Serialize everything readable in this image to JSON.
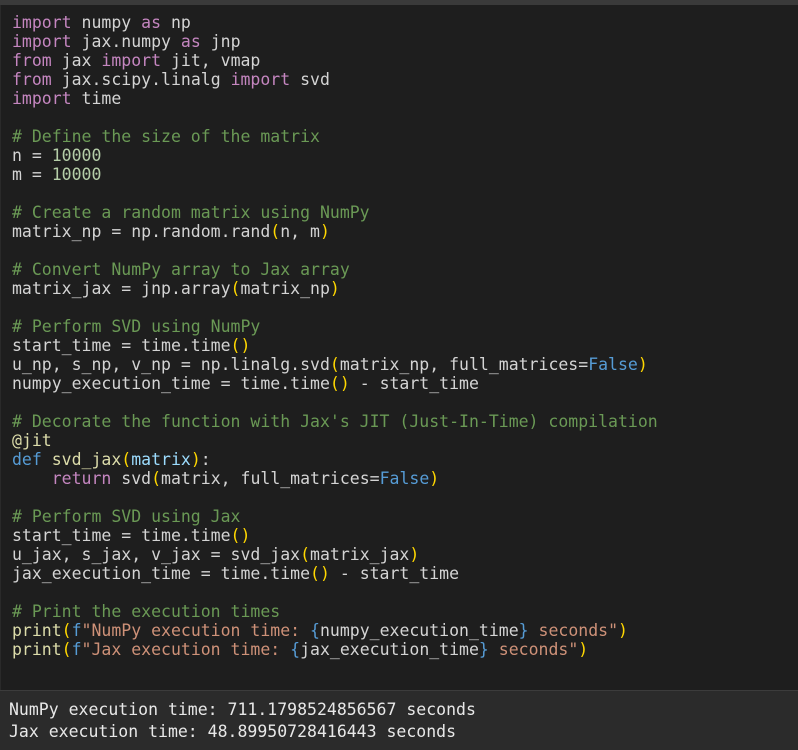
{
  "code_lines": [
    [
      {
        "t": "import",
        "c": "kw"
      },
      {
        "t": " numpy "
      },
      {
        "t": "as",
        "c": "kw"
      },
      {
        "t": " np"
      }
    ],
    [
      {
        "t": "import",
        "c": "kw"
      },
      {
        "t": " jax.numpy "
      },
      {
        "t": "as",
        "c": "kw"
      },
      {
        "t": " jnp"
      }
    ],
    [
      {
        "t": "from",
        "c": "kw"
      },
      {
        "t": " jax "
      },
      {
        "t": "import",
        "c": "kw"
      },
      {
        "t": " jit, vmap"
      }
    ],
    [
      {
        "t": "from",
        "c": "kw"
      },
      {
        "t": " jax.scipy.linalg "
      },
      {
        "t": "import",
        "c": "kw"
      },
      {
        "t": " svd"
      }
    ],
    [
      {
        "t": "import",
        "c": "kw"
      },
      {
        "t": " time"
      }
    ],
    [],
    [
      {
        "t": "# Define the size of the matrix",
        "c": "cm"
      }
    ],
    [
      {
        "t": "n = "
      },
      {
        "t": "10000",
        "c": "num"
      }
    ],
    [
      {
        "t": "m = "
      },
      {
        "t": "10000",
        "c": "num"
      }
    ],
    [],
    [
      {
        "t": "# Create a random matrix using NumPy",
        "c": "cm"
      }
    ],
    [
      {
        "t": "matrix_np = np.random.rand"
      },
      {
        "t": "(",
        "c": "par"
      },
      {
        "t": "n, m"
      },
      {
        "t": ")",
        "c": "par"
      }
    ],
    [],
    [
      {
        "t": "# Convert NumPy array to Jax array",
        "c": "cm"
      }
    ],
    [
      {
        "t": "matrix_jax = jnp.array"
      },
      {
        "t": "(",
        "c": "par"
      },
      {
        "t": "matrix_np"
      },
      {
        "t": ")",
        "c": "par"
      }
    ],
    [],
    [
      {
        "t": "# Perform SVD using NumPy",
        "c": "cm"
      }
    ],
    [
      {
        "t": "start_time = time.time"
      },
      {
        "t": "()",
        "c": "par"
      }
    ],
    [
      {
        "t": "u_np, s_np, v_np = np.linalg.svd"
      },
      {
        "t": "(",
        "c": "par"
      },
      {
        "t": "matrix_np, full_matrices="
      },
      {
        "t": "False",
        "c": "bool"
      },
      {
        "t": ")",
        "c": "par"
      }
    ],
    [
      {
        "t": "numpy_execution_time = time.time"
      },
      {
        "t": "()",
        "c": "par"
      },
      {
        "t": " - start_time"
      }
    ],
    [],
    [
      {
        "t": "# Decorate the function with Jax's JIT (Just-In-Time) compilation",
        "c": "cm"
      }
    ],
    [
      {
        "t": "@jit",
        "c": "dec"
      }
    ],
    [
      {
        "t": "def",
        "c": "kw2"
      },
      {
        "t": " "
      },
      {
        "t": "svd_jax",
        "c": "fn"
      },
      {
        "t": "(",
        "c": "par"
      },
      {
        "t": "matrix",
        "c": "var"
      },
      {
        "t": ")",
        "c": "par"
      },
      {
        "t": ":"
      }
    ],
    [
      {
        "t": "    "
      },
      {
        "t": "return",
        "c": "kw"
      },
      {
        "t": " svd"
      },
      {
        "t": "(",
        "c": "par"
      },
      {
        "t": "matrix, full_matrices="
      },
      {
        "t": "False",
        "c": "bool"
      },
      {
        "t": ")",
        "c": "par"
      }
    ],
    [],
    [
      {
        "t": "# Perform SVD using Jax",
        "c": "cm"
      }
    ],
    [
      {
        "t": "start_time = time.time"
      },
      {
        "t": "()",
        "c": "par"
      }
    ],
    [
      {
        "t": "u_jax, s_jax, v_jax = svd_jax"
      },
      {
        "t": "(",
        "c": "par"
      },
      {
        "t": "matrix_jax"
      },
      {
        "t": ")",
        "c": "par"
      }
    ],
    [
      {
        "t": "jax_execution_time = time.time"
      },
      {
        "t": "()",
        "c": "par"
      },
      {
        "t": " - start_time"
      }
    ],
    [],
    [
      {
        "t": "# Print the execution times",
        "c": "cm"
      }
    ],
    [
      {
        "t": "print",
        "c": "fn"
      },
      {
        "t": "(",
        "c": "par"
      },
      {
        "t": "f",
        "c": "kw2"
      },
      {
        "t": "\"NumPy execution time: ",
        "c": "str"
      },
      {
        "t": "{",
        "c": "kw2"
      },
      {
        "t": "numpy_execution_time"
      },
      {
        "t": "}",
        "c": "kw2"
      },
      {
        "t": " seconds\"",
        "c": "str"
      },
      {
        "t": ")",
        "c": "par"
      }
    ],
    [
      {
        "t": "print",
        "c": "fn"
      },
      {
        "t": "(",
        "c": "par"
      },
      {
        "t": "f",
        "c": "kw2"
      },
      {
        "t": "\"Jax execution time: ",
        "c": "str"
      },
      {
        "t": "{",
        "c": "kw2"
      },
      {
        "t": "jax_execution_time"
      },
      {
        "t": "}",
        "c": "kw2"
      },
      {
        "t": " seconds\"",
        "c": "str"
      },
      {
        "t": ")",
        "c": "par"
      }
    ]
  ],
  "output": {
    "line1": "NumPy execution time: 711.1798524856567 seconds",
    "line2": "Jax execution time: 48.89950728416443 seconds"
  }
}
